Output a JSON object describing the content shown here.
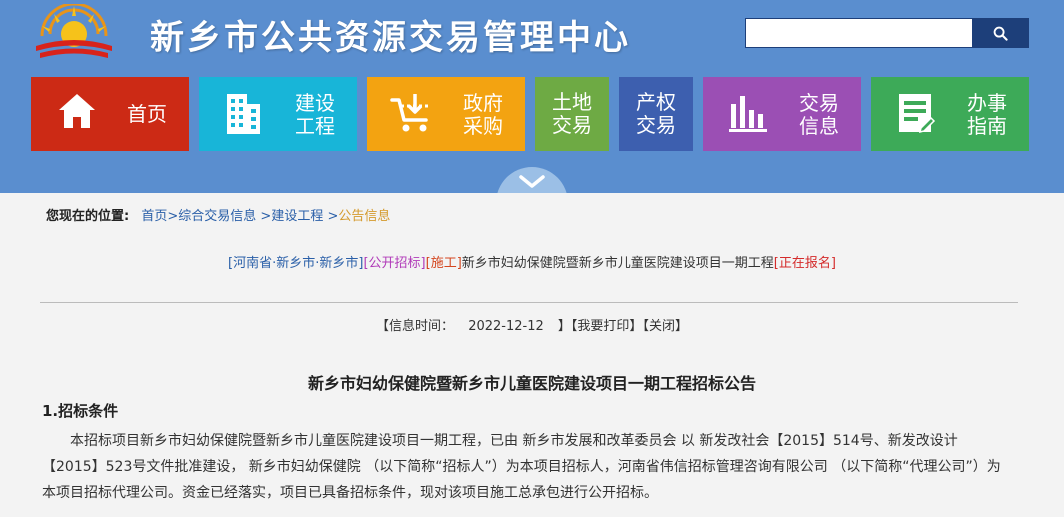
{
  "header": {
    "site_title": "新乡市公共资源交易管理中心",
    "logo_icon": "emblem-logo-icon",
    "search": {
      "placeholder": "",
      "value": "",
      "button_icon": "search-icon"
    }
  },
  "nav": {
    "home": {
      "label": "首页",
      "icon": "home-icon",
      "color": "#cc2a15"
    },
    "construction": {
      "label_line1": "建设",
      "label_line2": "工程",
      "icon": "building-icon",
      "color": "#18b5d8"
    },
    "procurement": {
      "label_line1": "政府",
      "label_line2": "采购",
      "icon": "cart-icon",
      "color": "#f3a311"
    },
    "land": {
      "label_line1": "土地",
      "label_line2": "交易",
      "color": "#6eaa44"
    },
    "property": {
      "label_line1": "产权",
      "label_line2": "交易",
      "color": "#3d5faf"
    },
    "trading_info": {
      "label_line1": "交易",
      "label_line2": "信息",
      "icon": "bar-chart-icon",
      "color": "#9b4fb4"
    },
    "guide": {
      "label_line1": "办事",
      "label_line2": "指南",
      "icon": "document-icon",
      "color": "#3daa58"
    }
  },
  "breadcrumb": {
    "label": "您现在的位置:",
    "home": "首页",
    "sep1": ">",
    "level2": "综合交易信息",
    "sep2": ">",
    "level3": "建设工程",
    "sep3": ">",
    "current": "公告信息"
  },
  "notice": {
    "region_tag": "[河南省·新乡市·新乡市]",
    "type_tag": "[公开招标]",
    "stage_tag": "[施工]",
    "name": "新乡市妇幼保健院暨新乡市儿童医院建设项目一期工程",
    "status_tag": "[正在报名]"
  },
  "info": {
    "time_prefix": "【信息时间：",
    "date": "2022-12-12",
    "time_suffix": "】",
    "print_label": "【我要打印】",
    "close_label": "【关闭】"
  },
  "article": {
    "title": "新乡市妇幼保健院暨新乡市儿童医院建设项目一期工程招标公告",
    "section1_heading": "1.招标条件",
    "section1_body": "本招标项目新乡市妇幼保健院暨新乡市儿童医院建设项目一期工程，已由 新乡市发展和改革委员会 以 新发改社会【2015】514号、新发改设计【2015】523号文件批准建设， 新乡市妇幼保健院 （以下简称“招标人”）为本项目招标人，河南省伟信招标管理咨询有限公司 （以下简称“代理公司”）为本项目招标代理公司。资金已经落实，项目已具备招标条件，现对该项目施工总承包进行公开招标。"
  }
}
